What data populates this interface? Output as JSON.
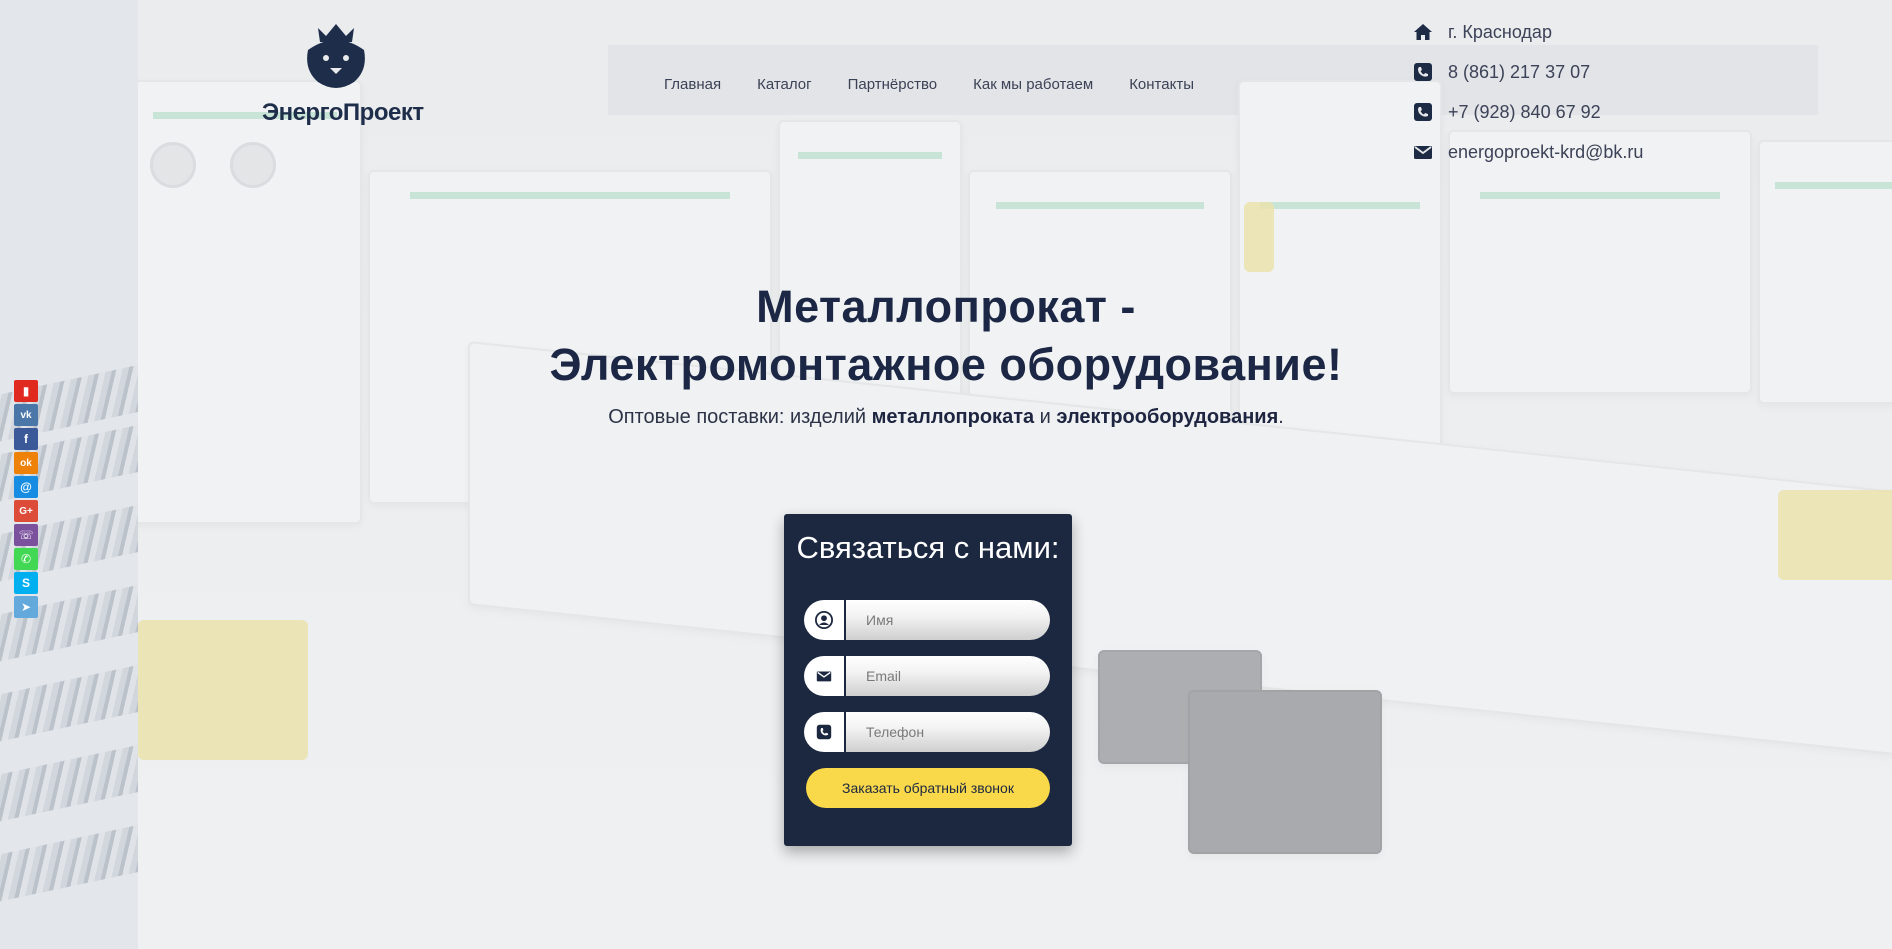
{
  "logo": {
    "name": "ЭнергоПроект"
  },
  "nav": [
    {
      "label": "Главная"
    },
    {
      "label": "Каталог"
    },
    {
      "label": "Партнёрство"
    },
    {
      "label": "Как мы работаем"
    },
    {
      "label": "Контакты"
    }
  ],
  "contacts": {
    "city": "г. Краснодар",
    "phone1": "8 (861) 217 37 07",
    "phone2": "+7 (928) 840 67 92",
    "email": "energoproekt-krd@bk.ru"
  },
  "hero": {
    "title_line1": "Металлопрокат -",
    "title_line2": "Электромонтажное оборудование!",
    "sub_prefix": "Оптовые поставки: изделий ",
    "sub_bold1": "металлопроката",
    "sub_mid": " и ",
    "sub_bold2": "электрооборудования",
    "sub_suffix": "."
  },
  "form": {
    "title": "Связаться с нами:",
    "name_placeholder": "Имя",
    "email_placeholder": "Email",
    "phone_placeholder": "Телефон",
    "submit_label": "Заказать обратный звонок"
  },
  "social": [
    {
      "icon": "bookmark-icon",
      "color": "#e02a20",
      "glyph": "▮"
    },
    {
      "icon": "vk-icon",
      "color": "#4a76a8",
      "glyph": "vk"
    },
    {
      "icon": "facebook-icon",
      "color": "#3b5998",
      "glyph": "f"
    },
    {
      "icon": "odnoklassniki-icon",
      "color": "#ee8208",
      "glyph": "ok"
    },
    {
      "icon": "mailru-icon",
      "color": "#168de2",
      "glyph": "@"
    },
    {
      "icon": "googleplus-icon",
      "color": "#dd4b39",
      "glyph": "G+"
    },
    {
      "icon": "viber-icon",
      "color": "#7b519d",
      "glyph": "☏"
    },
    {
      "icon": "whatsapp-icon",
      "color": "#43d854",
      "glyph": "✆"
    },
    {
      "icon": "skype-icon",
      "color": "#00aff0",
      "glyph": "S"
    },
    {
      "icon": "telegram-icon",
      "color": "#64a9dc",
      "glyph": "➤"
    }
  ]
}
